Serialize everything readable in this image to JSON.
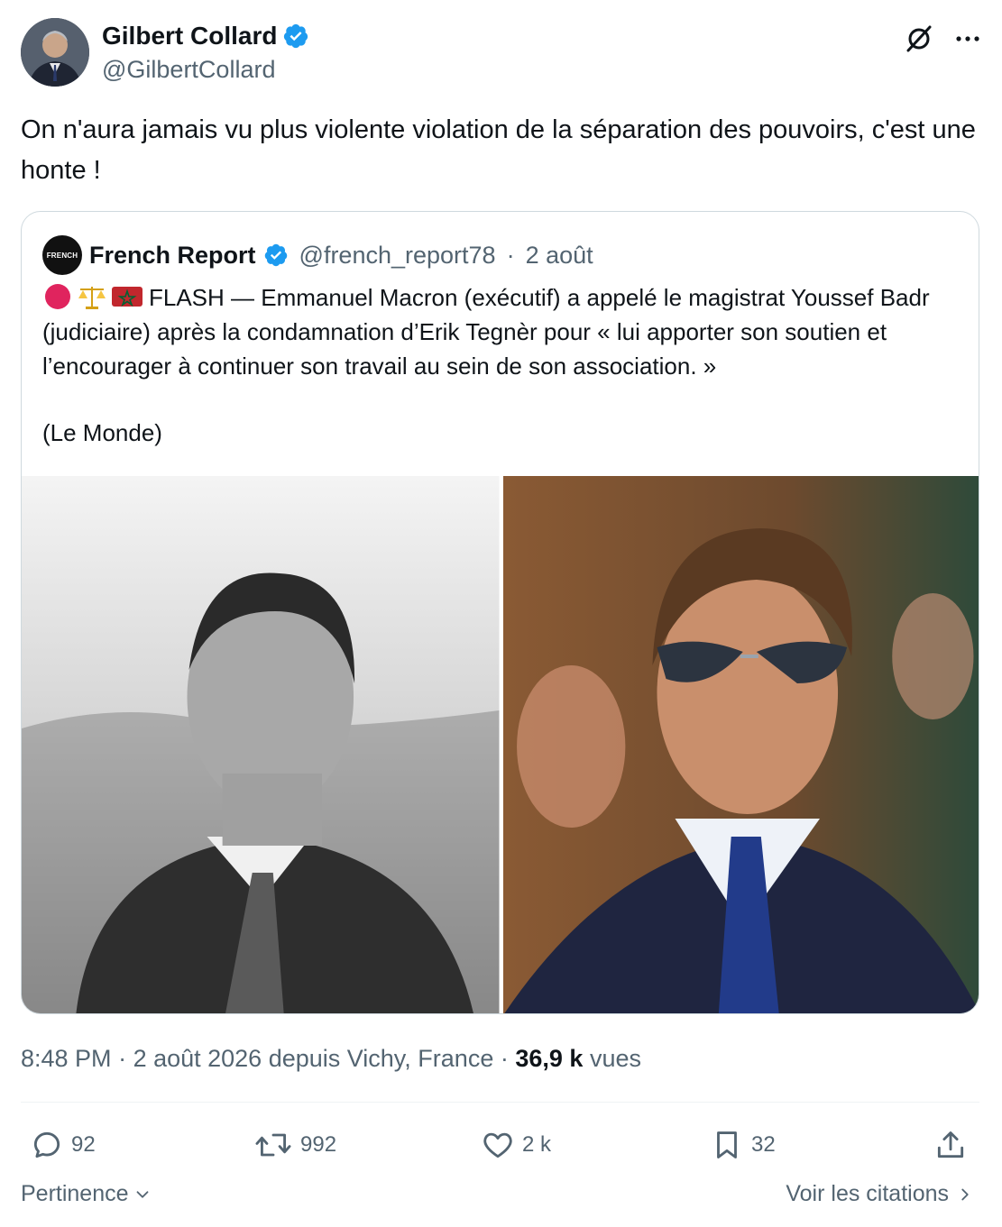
{
  "author": {
    "display_name": "Gilbert Collard",
    "handle": "@GilbertCollard",
    "verified": true
  },
  "icons": {
    "grok": "slashed-circle-icon",
    "more": "more-dots-icon"
  },
  "tweet": {
    "text": "On n'aura jamais vu plus violente violation de la séparation des pouvoirs, c'est une honte !"
  },
  "quote": {
    "avatar_text": "FRENCH",
    "name": "French Report",
    "handle": "@french_report78",
    "date": "2 août",
    "separator": "·",
    "text": "FLASH — Emmanuel Macron (exécutif) a appelé le magistrat Youssef Badr (judiciaire) après la condamnation d’Erik Tegnèr pour « lui apporter son soutien et l’encourager à continuer son travail au sein de son association. »",
    "source": "(Le Monde)",
    "emoji": [
      "red-circle",
      "balance-scale",
      "morocco-flag"
    ]
  },
  "meta": {
    "time": "8:48 PM",
    "sep": " · ",
    "date_location": "2 août 2026 depuis Vichy, France",
    "views_count": "36,9 k",
    "views_label": "vues"
  },
  "actions": {
    "replies": "92",
    "retweets": "992",
    "likes": "2 k",
    "bookmarks": "32"
  },
  "footer": {
    "sort_label": "Pertinence",
    "citations_label": "Voir les citations"
  },
  "colors": {
    "verified": "#1d9bf0",
    "text": "#0f1419",
    "muted": "#536471",
    "border": "#cfd9de"
  }
}
